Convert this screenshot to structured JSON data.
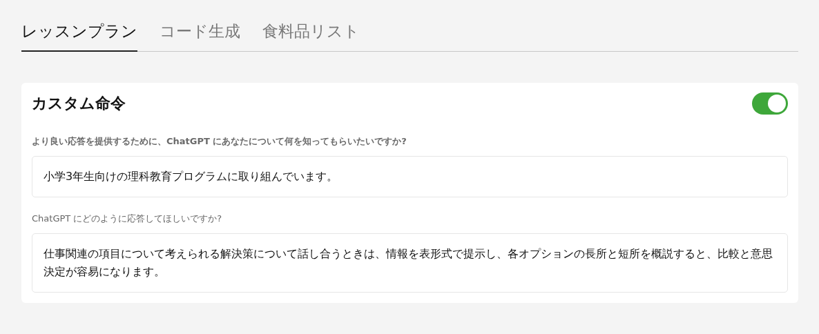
{
  "tabs": [
    {
      "label": "レッスンプラン",
      "selected": true
    },
    {
      "label": "コード生成",
      "selected": false
    },
    {
      "label": "食料品リスト",
      "selected": false
    }
  ],
  "card": {
    "title": "カスタム命令",
    "enabled": true,
    "fields": [
      {
        "label": "より良い応答を提供するために、ChatGPT にあなたについて何を知ってもらいたいですか?",
        "value": "小学3年生向けの理科教育プログラムに取り組んでいます。",
        "focused": true
      },
      {
        "label": "ChatGPT にどのように応答してほしいですか?",
        "value": "仕事関連の項目について考えられる解決策について話し合うときは、情報を表形式で提示し、各オプションの長所と短所を概説すると、比較と意思決定が容易になります。",
        "focused": false
      }
    ]
  }
}
